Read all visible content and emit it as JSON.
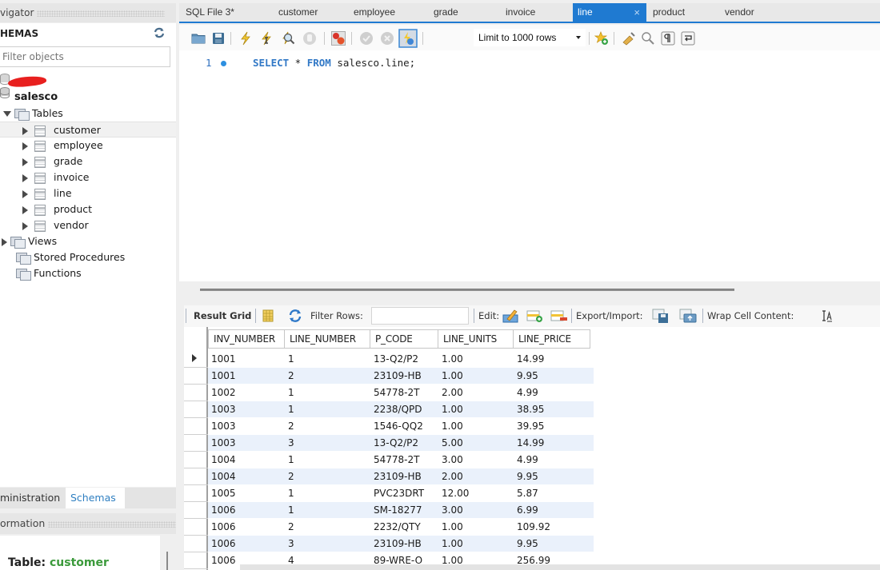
{
  "navigator": {
    "header": "vigator",
    "section_title": "HEMAS",
    "filter_placeholder": "Filter objects",
    "schema_name": "salesco",
    "tables_label": "Tables",
    "tables": [
      {
        "name": "customer",
        "selected": true
      },
      {
        "name": "employee"
      },
      {
        "name": "grade"
      },
      {
        "name": "invoice"
      },
      {
        "name": "line"
      },
      {
        "name": "product"
      },
      {
        "name": "vendor"
      }
    ],
    "views_label": "Views",
    "stored_procedures_label": "Stored Procedures",
    "functions_label": "Functions",
    "bottom_tabs": [
      {
        "label": "ministration",
        "active": false
      },
      {
        "label": "Schemas",
        "active": true
      }
    ],
    "info_header": "ormation",
    "info_table_label": "Table:",
    "info_table_name": "customer"
  },
  "editor_tabs": [
    {
      "label": "SQL File 3*",
      "active": false
    },
    {
      "label": "customer",
      "active": false
    },
    {
      "label": "employee",
      "active": false
    },
    {
      "label": "grade",
      "active": false
    },
    {
      "label": "invoice",
      "active": false
    },
    {
      "label": "line",
      "active": true,
      "closable": true
    },
    {
      "label": "product",
      "active": false
    },
    {
      "label": "vendor",
      "active": false
    }
  ],
  "toolbar": {
    "icons": [
      "open-folder-icon",
      "save-icon",
      "execute-icon",
      "execute-current-icon",
      "explain-icon",
      "stop-icon",
      "toggle-error-icon",
      "commit-icon",
      "rollback-icon",
      "autocommit-icon",
      "bookmark-icon",
      "beautify-icon",
      "find-icon",
      "invisible-chars-icon",
      "wrap-icon"
    ],
    "limit_label": "Limit to 1000 rows",
    "close_glyph": "×"
  },
  "editor": {
    "line_number": "1",
    "code_kw1": "SELECT",
    "code_mid": " * ",
    "code_kw2": "FROM",
    "code_rest": " salesco.line;"
  },
  "result_toolbar": {
    "result_grid_label": "Result Grid",
    "filter_rows_label": "Filter Rows:",
    "filter_value": "",
    "edit_label": "Edit:",
    "export_import_label": "Export/Import:",
    "wrap_label": "Wrap Cell Content:"
  },
  "grid": {
    "columns": [
      "INV_NUMBER",
      "LINE_NUMBER",
      "P_CODE",
      "LINE_UNITS",
      "LINE_PRICE"
    ],
    "rows": [
      [
        "1001",
        "1",
        "13-Q2/P2",
        "1.00",
        "14.99"
      ],
      [
        "1001",
        "2",
        "23109-HB",
        "1.00",
        "9.95"
      ],
      [
        "1002",
        "1",
        "54778-2T",
        "2.00",
        "4.99"
      ],
      [
        "1003",
        "1",
        "2238/QPD",
        "1.00",
        "38.95"
      ],
      [
        "1003",
        "2",
        "1546-QQ2",
        "1.00",
        "39.95"
      ],
      [
        "1003",
        "3",
        "13-Q2/P2",
        "5.00",
        "14.99"
      ],
      [
        "1004",
        "1",
        "54778-2T",
        "3.00",
        "4.99"
      ],
      [
        "1004",
        "2",
        "23109-HB",
        "2.00",
        "9.95"
      ],
      [
        "1005",
        "1",
        "PVC23DRT",
        "12.00",
        "5.87"
      ],
      [
        "1006",
        "1",
        "SM-18277",
        "3.00",
        "6.99"
      ],
      [
        "1006",
        "2",
        "2232/QTY",
        "1.00",
        "109.92"
      ],
      [
        "1006",
        "3",
        "23109-HB",
        "1.00",
        "9.95"
      ],
      [
        "1006",
        "4",
        "89-WRE-O",
        "1.00",
        "256.99"
      ]
    ]
  },
  "colors": {
    "accent": "#1f7ad1",
    "alt_row": "#eaf1fb",
    "schemas_tab": "#2f7fc1",
    "info_table_name": "#3b9a3b"
  }
}
